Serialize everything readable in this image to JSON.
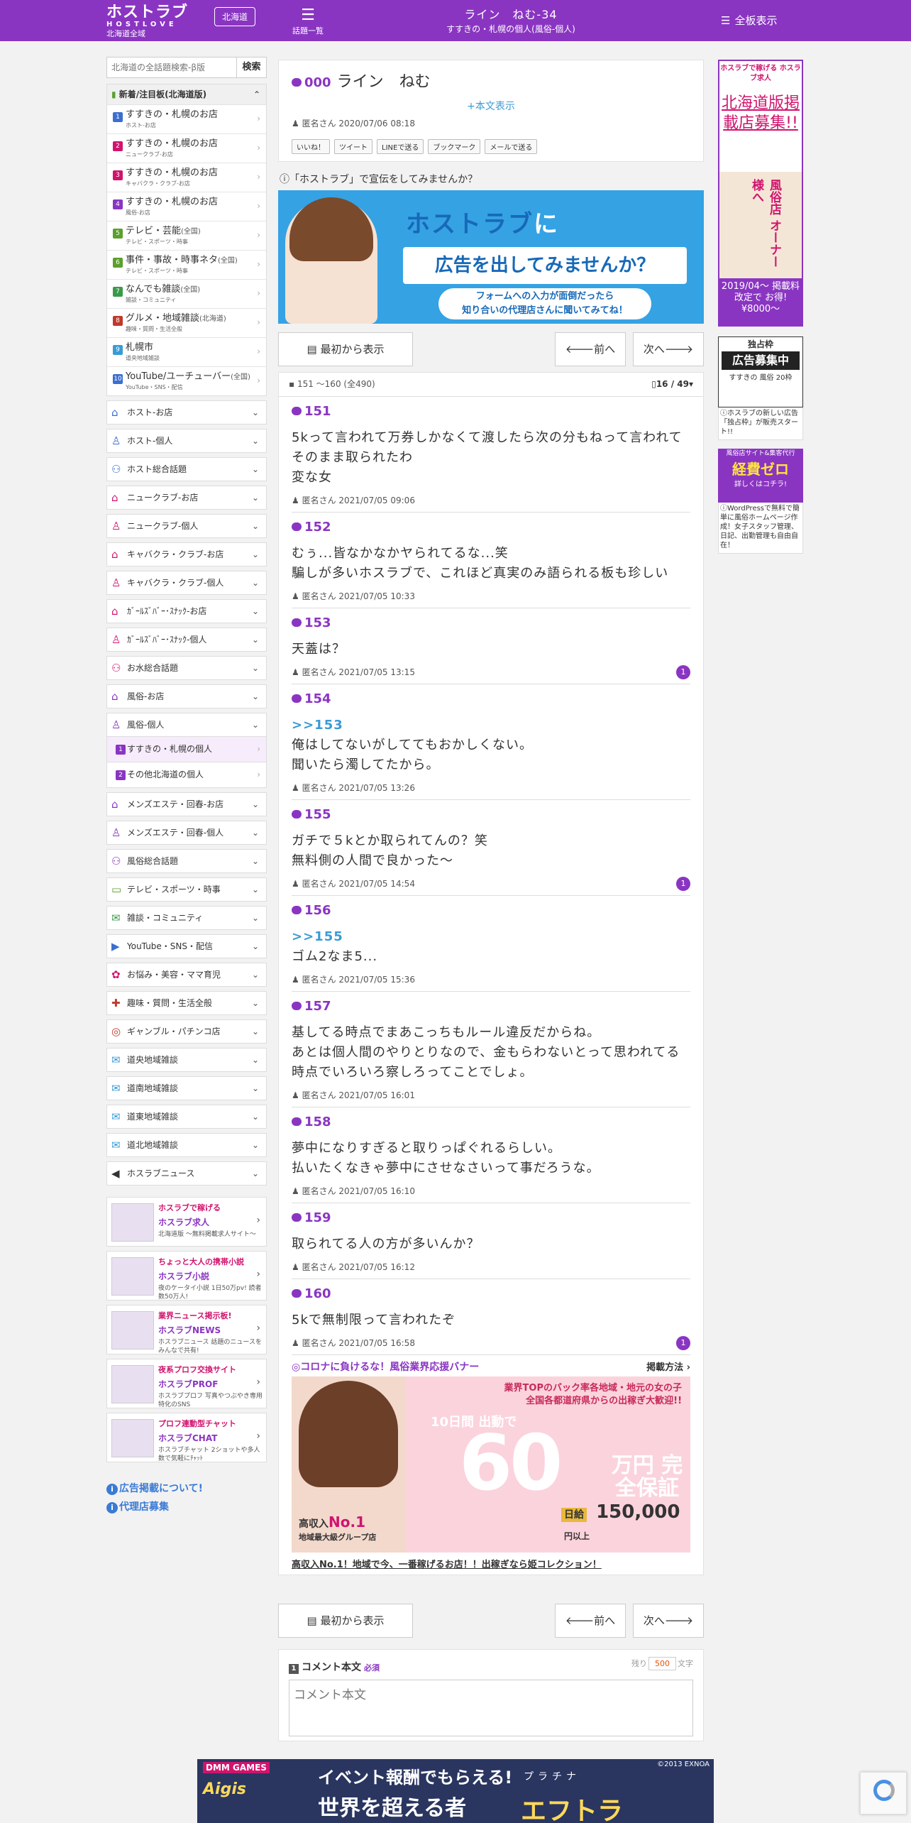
{
  "header": {
    "logo_main": "ホストラブ",
    "logo_sub": "HOSTLOVE",
    "region_all": "北海道全域",
    "region_pill": "北海道",
    "topics_label": "話題一覧",
    "thread_title": "ライン　ねむ-34",
    "thread_board": "すすきの・札幌の個人(風俗-個人)",
    "all_boards_label": "全板表示"
  },
  "sidebar": {
    "search_placeholder": "北海道の全話題検索-β版",
    "search_button": "検索",
    "new_header": "新着/注目板(北海道版)",
    "new_items": [
      {
        "num": "1",
        "title": "すすきの・札幌のお店",
        "tag": "",
        "sub": "ホスト-お店",
        "color": "#3a6fd0"
      },
      {
        "num": "2",
        "title": "すすきの・札幌のお店",
        "tag": "",
        "sub": "ニュークラブ-お店",
        "color": "#d0146e"
      },
      {
        "num": "3",
        "title": "すすきの・札幌のお店",
        "tag": "",
        "sub": "キャバクラ・クラブ-お店",
        "color": "#d0146e"
      },
      {
        "num": "4",
        "title": "すすきの・札幌のお店",
        "tag": "",
        "sub": "風俗-お店",
        "color": "#8a35c2"
      },
      {
        "num": "5",
        "title": "テレビ・芸能",
        "tag": "(全国)",
        "sub": "テレビ・スポーツ・時事",
        "color": "#5aa02c"
      },
      {
        "num": "6",
        "title": "事件・事故・時事ネタ",
        "tag": "(全国)",
        "sub": "テレビ・スポーツ・時事",
        "color": "#5aa02c"
      },
      {
        "num": "7",
        "title": "なんでも雑談",
        "tag": "(全国)",
        "sub": "雑談・コミュニティ",
        "color": "#3a9a4a"
      },
      {
        "num": "8",
        "title": "グルメ・地域雑談",
        "tag": "(北海道)",
        "sub": "趣味・質問・生活全般",
        "color": "#c0392b"
      },
      {
        "num": "9",
        "title": "札幌市",
        "tag": "",
        "sub": "道央地域雑談",
        "color": "#3a9bd5"
      },
      {
        "num": "10",
        "title": "YouTube/ユーチューバー",
        "tag": "(全国)",
        "sub": "YouTube・SNS・配信",
        "color": "#3a6fd0"
      }
    ],
    "categories_a": [
      {
        "icon": "⌂",
        "label": "ホスト-お店",
        "color": "#3a6fd0"
      },
      {
        "icon": "♙",
        "label": "ホスト-個人",
        "color": "#3a6fd0"
      },
      {
        "icon": "⚇",
        "label": "ホスト総合話題",
        "color": "#3a6fd0"
      },
      {
        "icon": "⌂",
        "label": "ニュークラブ-お店",
        "color": "#d0146e"
      },
      {
        "icon": "♙",
        "label": "ニュークラブ-個人",
        "color": "#d0146e"
      },
      {
        "icon": "⌂",
        "label": "キャバクラ・クラブ-お店",
        "color": "#d0146e"
      },
      {
        "icon": "♙",
        "label": "キャバクラ・クラブ-個人",
        "color": "#d0146e"
      },
      {
        "icon": "⌂",
        "label": "ｶﾞｰﾙｽﾞﾊﾞｰ･ｽﾅｯｸ-お店",
        "color": "#d0146e"
      },
      {
        "icon": "♙",
        "label": "ｶﾞｰﾙｽﾞﾊﾞｰ･ｽﾅｯｸ-個人",
        "color": "#d0146e"
      },
      {
        "icon": "⚇",
        "label": "お水総合話題",
        "color": "#d0146e"
      },
      {
        "icon": "⌂",
        "label": "風俗-お店",
        "color": "#8a35c2"
      },
      {
        "icon": "♙",
        "label": "風俗-個人",
        "color": "#8a35c2"
      }
    ],
    "sub_items": [
      {
        "num": "1",
        "label": "すすきの・札幌の個人"
      },
      {
        "num": "2",
        "label": "その他北海道の個人"
      }
    ],
    "categories_b": [
      {
        "icon": "⌂",
        "label": "メンズエステ・回春-お店",
        "color": "#8a35c2"
      },
      {
        "icon": "♙",
        "label": "メンズエステ・回春-個人",
        "color": "#8a35c2"
      },
      {
        "icon": "⚇",
        "label": "風俗総合話題",
        "color": "#8a35c2"
      },
      {
        "icon": "▭",
        "label": "テレビ・スポーツ・時事",
        "color": "#5aa02c"
      },
      {
        "icon": "✉",
        "label": "雑談・コミュニティ",
        "color": "#3a9a4a"
      },
      {
        "icon": "▶",
        "label": "YouTube・SNS・配信",
        "color": "#3a6fd0"
      },
      {
        "icon": "✿",
        "label": "お悩み・美容・ママ育児",
        "color": "#d0146e"
      },
      {
        "icon": "✚",
        "label": "趣味・質問・生活全般",
        "color": "#c0392b"
      },
      {
        "icon": "◎",
        "label": "ギャンブル・パチンコ店",
        "color": "#c0392b"
      },
      {
        "icon": "✉",
        "label": "道央地域雑談",
        "color": "#3a9bd5"
      },
      {
        "icon": "✉",
        "label": "道南地域雑談",
        "color": "#3a9bd5"
      },
      {
        "icon": "✉",
        "label": "道東地域雑談",
        "color": "#3a9bd5"
      },
      {
        "icon": "✉",
        "label": "道北地域雑談",
        "color": "#3a9bd5"
      },
      {
        "icon": "◀",
        "label": "ホスラブニュース",
        "color": "#333333"
      }
    ],
    "banners": [
      {
        "top": "ホスラブで稼げる",
        "name": "ホスラブ求人",
        "sub": "北海道版 〜無料掲載求人サイト〜"
      },
      {
        "top": "ちょっと大人の携帯小説",
        "name": "ホスラブ小説",
        "sub": "夜のケータイ小説 1日50万pv! 読者数50万人!"
      },
      {
        "top": "業界ニュース掲示板!",
        "name": "ホスラブNEWS",
        "sub": "ホスラブニュース 話題のニュースをみんなで共有!"
      },
      {
        "top": "夜系プロフ交換サイト",
        "name": "ホスラブPROF",
        "sub": "ホスラブプロフ 写真やつぶやき専用特化のSNS"
      },
      {
        "top": "プロフ連動型チャット",
        "name": "ホスラブCHAT",
        "sub": "ホスラブチャット 2ショットや多人数で気軽にﾁｬｯﾄ"
      }
    ],
    "link_ads": "広告掲載について!",
    "link_agency": "代理店募集"
  },
  "thread": {
    "num": "000",
    "title": "ライン　ねむ",
    "more": "+本文表示",
    "author": "匿名さん 2020/07/06 08:18",
    "shares": [
      "いいね！",
      "ツイート",
      "LINEで送る",
      "ブックマーク",
      "メールで送る"
    ]
  },
  "ad_question": "「ホストラブ」で宣伝をしてみませんか？",
  "ad_banner": {
    "line1": "ホストラブ",
    "line1b": "に",
    "line2": "広告を出してみませんか？",
    "line3a": "フォームへの入力が面倒だったら",
    "line3b": "知り合いの代理店さんに聞いてみてね！"
  },
  "nav": {
    "first": "最初から表示",
    "prev": "前へ",
    "next": "次へ"
  },
  "pager": {
    "range": "151 〜160 (全490)",
    "page": "16 / 49"
  },
  "posts": [
    {
      "num": "151",
      "ref": "",
      "body": [
        "5kって言われて万券しかなくて渡したら次の分もねって言われてそのまま取られたわ",
        "変な女"
      ],
      "meta": "匿名さん 2021/07/05 09:06",
      "badge": ""
    },
    {
      "num": "152",
      "ref": "",
      "body": [
        "むぅ...皆なかなかヤられてるな...笑",
        "騙しが多いホスラブで、これほど真実のみ語られる板も珍しい"
      ],
      "meta": "匿名さん 2021/07/05 10:33",
      "badge": ""
    },
    {
      "num": "153",
      "ref": "",
      "body": [
        "天蓋は？"
      ],
      "meta": "匿名さん 2021/07/05 13:15",
      "badge": "1"
    },
    {
      "num": "154",
      "ref": ">>153",
      "body": [
        "俺はしてないがしててもおかしくない。",
        "聞いたら濁してたから。"
      ],
      "meta": "匿名さん 2021/07/05 13:26",
      "badge": ""
    },
    {
      "num": "155",
      "ref": "",
      "body": [
        "ガチで５kとか取られてんの？笑",
        "無料側の人間で良かった～"
      ],
      "meta": "匿名さん 2021/07/05 14:54",
      "badge": "1"
    },
    {
      "num": "156",
      "ref": ">>155",
      "body": [
        "ゴム2なま5..."
      ],
      "meta": "匿名さん 2021/07/05 15:36",
      "badge": ""
    },
    {
      "num": "157",
      "ref": "",
      "body": [
        "基してる時点でまあこっちもルール違反だからね。",
        "あとは個人間のやりとりなので、金もらわないとって思われてる時点でいろいろ察しろってことでしょ。"
      ],
      "meta": "匿名さん 2021/07/05 16:01",
      "badge": ""
    },
    {
      "num": "158",
      "ref": "",
      "body": [
        "夢中になりすぎると取りっぱぐれるらしい。",
        "払いたくなきゃ夢中にさせなさいって事だろうな。"
      ],
      "meta": "匿名さん 2021/07/05 16:10",
      "badge": ""
    },
    {
      "num": "159",
      "ref": "",
      "body": [
        "取られてる人の方が多いんか？"
      ],
      "meta": "匿名さん 2021/07/05 16:12",
      "badge": ""
    },
    {
      "num": "160",
      "ref": "",
      "body": [
        "5kで無制限って言われたぞ"
      ],
      "meta": "匿名さん 2021/07/05 16:58",
      "badge": "1"
    }
  ],
  "covid_ad": {
    "head": "◎コロナに負けるな！風俗業界応援バナー",
    "how": "掲載方法",
    "line1": "業界TOPのバック率各地域・地元の女の子",
    "line2": "全国各都道府県からの出稼ぎ大歓迎!!",
    "days": "10日間 出動で",
    "big": "60",
    "unit": "万円 完全保証",
    "daily": "日給",
    "daily_val": "150,000",
    "daily_unit": "円以上",
    "high": "高収入",
    "no1": "No.1",
    "group": "地域最大級グループ店",
    "link": "高収入No.1！地域で今、一番稼げるお店！！出稼ぎなら姫コレクション！"
  },
  "comment": {
    "num": "1",
    "label": "コメント本文",
    "required": "必須",
    "remain_label": "残り",
    "remain": "500",
    "remain_unit": "文字",
    "placeholder": "コメント本文"
  },
  "right": {
    "ad1_top": "ホスラブで稼げる ホスラブ求人",
    "ad1_main": "北海道版掲載店募集!!",
    "ad1_mid": "風俗店 オーナー様へ",
    "ad1_bottom": "2019/04〜 掲載料改定で お得!¥8000〜",
    "ad2_h": "独占枠",
    "ad2_m": "広告募集中",
    "ad2_s": "すすきの 風俗 20枠",
    "ad2_txt": "ホスラブの新しい広告「独占枠」が販売スタート!!",
    "ad3_s1": "風俗店サイト&集客代行",
    "ad3_s2": "経費ゼロ",
    "ad3_s3": "詳しくはコチラ!",
    "ad3_txt": "WordPressで無料で簡単に風俗ホームページ作成！女子スタッフ管理、日記、出勤管理も自由自在！"
  },
  "footer_ad": {
    "brand": "DMM GAMES",
    "game": "Aigis",
    "line1": "イベント報酬でもらえる!",
    "line2": "世界を超える者",
    "name": "エフトラ",
    "rank": "プラチナ",
    "copy": "©2013 EXNOA"
  }
}
